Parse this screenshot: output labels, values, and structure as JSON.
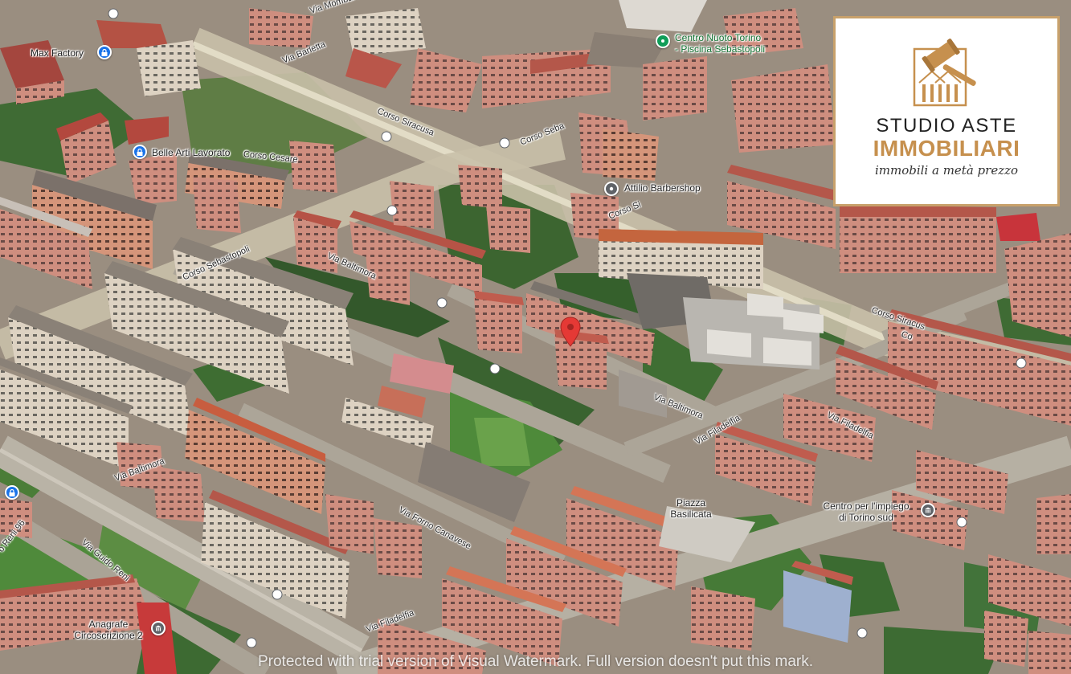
{
  "places": [
    {
      "id": "max-factory",
      "label": "Max Factory",
      "icon": "lock-icon"
    },
    {
      "id": "centro-nuoto",
      "label_line1": "Centro Nuoto Torino",
      "label_line2": "- Piscina Sebastopoli",
      "icon": "swimming-pin-icon"
    },
    {
      "id": "belle-arti",
      "label": "Belle Arti Lavorato",
      "icon": "lock-icon"
    },
    {
      "id": "attilio",
      "label": "Attilio Barbershop",
      "icon": "barbershop-pin-icon"
    },
    {
      "id": "piazza-basilicata",
      "label_line1": "Piazza",
      "label_line2": "Basilicata"
    },
    {
      "id": "centro-impiego",
      "label_line1": "Centro per l'impiego",
      "label_line2": "di Torino sud",
      "icon": "government-building-icon"
    },
    {
      "id": "anagrafe",
      "label_line1": "Anagrafe",
      "label_line2": "Circoscrizione 2",
      "icon": "government-building-icon"
    }
  ],
  "streets": {
    "via_mombarcaro": "Via Mombarc",
    "via_barletta": "Via Barletta",
    "corso_siracusa_top": "Corso Siracusa",
    "corso_sebastopoli_top": "Corso Seba",
    "corso_cesare": "Corso Cesare",
    "corso_si": "Corso Si",
    "via_baltimora_top": "Via Baltimora",
    "corso_sebastopoli_left": "Corso Sebastopoli",
    "corso_siracusa_right": "Corso Siracus",
    "co_right": "Co",
    "via_baltimora_mid": "Via Baltimora",
    "via_filadelfia_mid": "Via Filadelfia",
    "via_filadelfia_right": "Via Filadelfia",
    "via_baltimora_left": "Via Baltimora",
    "via_forno": "Via Forno Canavese",
    "via_guido_reni": "Via Guido Reni",
    "reni_96": "o Reni 96",
    "via_filadelfia_bottom": "Via Filadelfia"
  },
  "marker": {
    "icon": "location-pin-icon",
    "color": "#e53935"
  },
  "logo": {
    "icon": "gavel-house-icon",
    "line1": "STUDIO ASTE",
    "line2": "IMMOBILIARI",
    "tagline": "immobili a metà prezzo",
    "accent_color": "#c6904e",
    "border_color": "#c8a16b"
  },
  "watermark": "Protected with trial version of Visual Watermark. Full version doesn't put this mark."
}
